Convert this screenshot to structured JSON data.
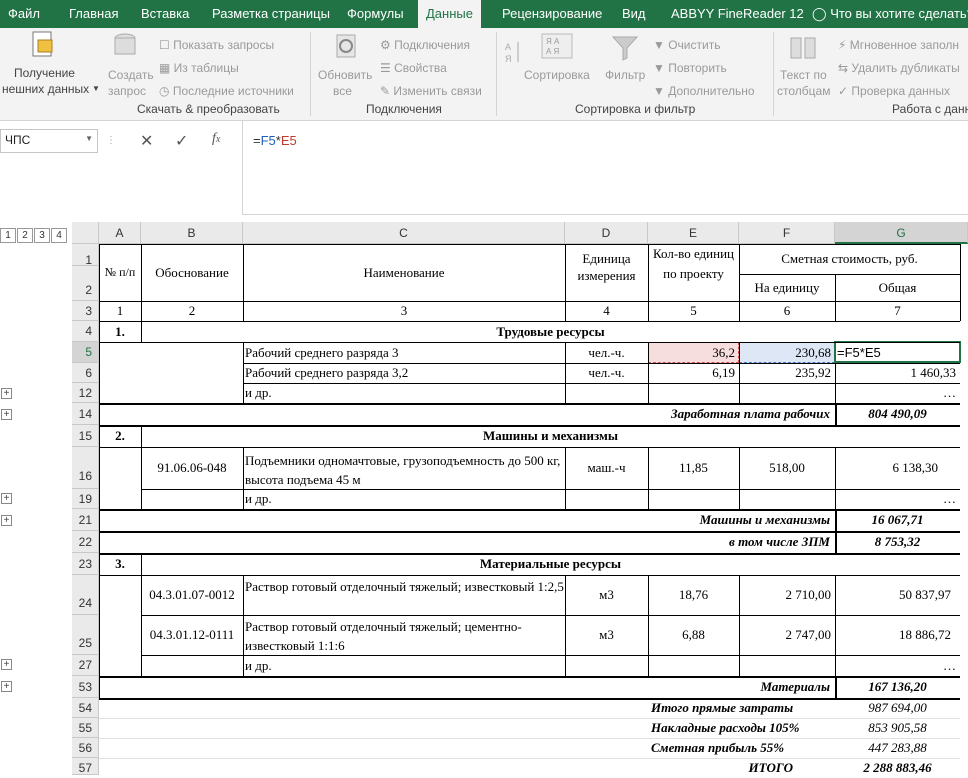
{
  "ribbon": {
    "tabs": [
      "Файл",
      "Главная",
      "Вставка",
      "Разметка страницы",
      "Формулы",
      "Данные",
      "Рецензирование",
      "Вид",
      "ABBYY FineReader 12",
      "Что вы хотите сделать?"
    ],
    "get_data": [
      "Получение",
      "нешних данных"
    ],
    "create_query": [
      "Создать",
      "запрос"
    ],
    "show_queries": "Показать запросы",
    "from_table": "Из таблицы",
    "recent_sources": "Последние источники",
    "group_transform": "Скачать & преобразовать",
    "refresh_all": [
      "Обновить",
      "все"
    ],
    "connections": "Подключения",
    "properties": "Свойства",
    "edit_links": "Изменить связи",
    "group_connections": "Подключения",
    "sort": "Сортировка",
    "filter": "Фильтр",
    "clear": "Очистить",
    "reapply": "Повторить",
    "advanced": "Дополнительно",
    "group_sort": "Сортировка и фильтр",
    "text_to_columns": [
      "Текст по",
      "столбцам"
    ],
    "flash_fill": "Мгновенное заполн",
    "remove_dup": "Удалить дубликаты",
    "data_validation": "Проверка данных",
    "group_data_tools": "Работа с данн"
  },
  "formula_bar": {
    "name_box": "ЧПС",
    "formula": "=F5*E5",
    "f_ref": "F5",
    "e_ref": "E5"
  },
  "outline_levels": [
    "1",
    "2",
    "3",
    "4"
  ],
  "columns": [
    "A",
    "B",
    "C",
    "D",
    "E",
    "F",
    "G"
  ],
  "rows_nums": [
    "1",
    "2",
    "3",
    "4",
    "5",
    "6",
    "12",
    "14",
    "15",
    "16",
    "19",
    "21",
    "22",
    "23",
    "24",
    "25",
    "27",
    "53",
    "54",
    "55",
    "56",
    "57"
  ],
  "table": {
    "h_num": "№ п/п",
    "h_basis": "Обоснование",
    "h_name": "Наименование",
    "h_unit": "Единица измерения",
    "h_qty": "Кол-во единиц по проекту",
    "h_cost": "Сметная стоимость, руб.",
    "h_per_unit": "На единицу",
    "h_total": "Общая",
    "idx": [
      "1",
      "2",
      "3",
      "4",
      "5",
      "6",
      "7"
    ],
    "sec1_num": "1.",
    "sec1_title": "Трудовые ресурсы",
    "r5": {
      "name": "Рабочий среднего разряда 3",
      "unit": "чел.-ч.",
      "qty": "36,2",
      "price": "230,68",
      "total": "=F5*E5"
    },
    "r6": {
      "name": "Рабочий среднего разряда 3,2",
      "unit": "чел.-ч.",
      "qty": "6,19",
      "price": "235,92",
      "total": "1 460,33"
    },
    "etc": "и др.",
    "ellipsis": "…",
    "sum1_label": "Заработная плата рабочих",
    "sum1_value": "804 490,09",
    "sec2_num": "2.",
    "sec2_title": "Машины и механизмы",
    "r16": {
      "basis": "91.06.06-048",
      "name": "Подъемники одномачтовые, грузоподъемность до 500 кг, высота подъема 45 м",
      "unit": "маш.-ч",
      "qty": "11,85",
      "price": "518,00",
      "total": "6 138,30"
    },
    "sum2_label": "Машины и механизмы",
    "sum2_value": "16 067,71",
    "sum2b_label": "в том числе ЗПМ",
    "sum2b_value": "8 753,32",
    "sec3_num": "3.",
    "sec3_title": "Материальные ресурсы",
    "r24": {
      "basis": "04.3.01.07-0012",
      "name": "Раствор готовый отделочный тяжелый; известковый 1:2,5",
      "unit": "м3",
      "qty": "18,76",
      "price": "2 710,00",
      "total": "50 837,97"
    },
    "r25": {
      "basis": "04.3.01.12-0111",
      "name": "Раствор готовый отделочный тяжелый; цементно-известковый 1:1:6",
      "unit": "м3",
      "qty": "6,88",
      "price": "2 747,00",
      "total": "18 886,72"
    },
    "sum3_label": "Материалы",
    "sum3_value": "167 136,20",
    "t54_label": "Итого прямые затраты",
    "t54_value": "987 694,00",
    "t55_label": "Накладные расходы 105%",
    "t55_value": "853 905,58",
    "t56_label": "Сметная прибыль 55%",
    "t56_value": "447 283,88",
    "t57_label": "ИТОГО",
    "t57_value": "2 288 883,46"
  }
}
